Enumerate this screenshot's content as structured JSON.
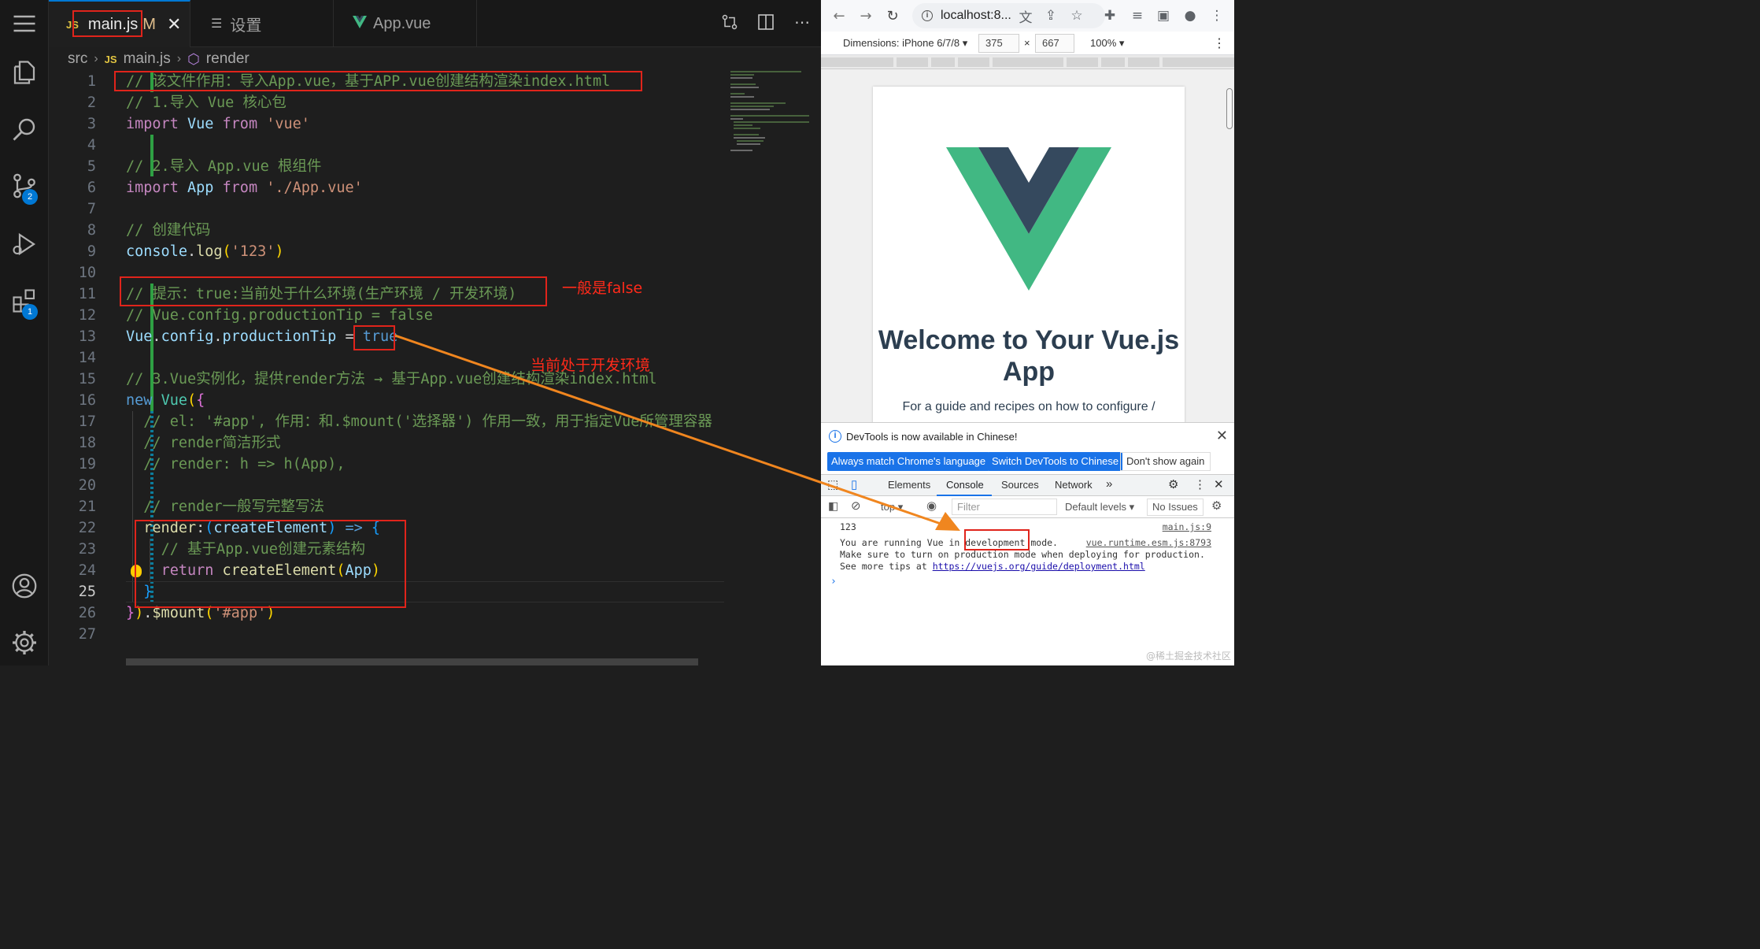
{
  "tabs": [
    {
      "label": "main.js",
      "modified": "M",
      "icon": "JS",
      "active": true
    },
    {
      "label": "设置",
      "active": false
    },
    {
      "label": "App.vue",
      "active": false
    }
  ],
  "breadcrumb": [
    "src",
    "main.js",
    "render"
  ],
  "activity": {
    "scm_badge": "2",
    "extensions_badge": "1"
  },
  "editor": {
    "current_line": 25,
    "lines": [
      {
        "n": "1",
        "html": "<span class='c-comment'>// 该文件作用：导入App.vue，基于APP.vue创建结构渲染index.html</span>"
      },
      {
        "n": "2",
        "html": "<span class='c-comment'>// 1.导入 Vue 核心包</span>"
      },
      {
        "n": "3",
        "html": "<span class='c-kw'>import</span> <span class='c-var'>Vue</span> <span class='c-kw'>from</span> <span class='c-str'>'vue'</span>"
      },
      {
        "n": "4",
        "html": ""
      },
      {
        "n": "5",
        "html": "<span class='c-comment'>// 2.导入 App.vue 根组件</span>"
      },
      {
        "n": "6",
        "html": "<span class='c-kw'>import</span> <span class='c-var'>App</span> <span class='c-kw'>from</span> <span class='c-str'>'./App.vue'</span>"
      },
      {
        "n": "7",
        "html": ""
      },
      {
        "n": "8",
        "html": "<span class='c-comment'>// 创建代码</span>"
      },
      {
        "n": "9",
        "html": "<span class='c-var'>console</span><span class='c-pun'>.</span><span class='c-fn'>log</span><span class='c-brace1'>(</span><span class='c-str'>'123'</span><span class='c-brace1'>)</span>"
      },
      {
        "n": "10",
        "html": ""
      },
      {
        "n": "11",
        "html": "<span class='c-comment'>// 提示：true:当前处于什么环境(生产环境 / 开发环境)</span>"
      },
      {
        "n": "12",
        "html": "<span class='c-comment'>// Vue.config.productionTip = false</span>"
      },
      {
        "n": "13",
        "html": "<span class='c-var'>Vue</span><span class='c-pun'>.</span><span class='c-var'>config</span><span class='c-pun'>.</span><span class='c-var'>productionTip</span> <span class='c-pun'>=</span> <span class='c-bool'>true</span>"
      },
      {
        "n": "14",
        "html": ""
      },
      {
        "n": "15",
        "html": "<span class='c-comment'>// 3.Vue实例化，提供render方法 → 基于App.vue创建结构渲染index.html</span>"
      },
      {
        "n": "16",
        "html": "<span class='c-bool'>new</span> <span class='c-cls'>Vue</span><span class='c-brace1'>(</span><span class='c-brace2'>{</span>"
      },
      {
        "n": "17",
        "html": "  <span class='c-comment'>// el: '#app', 作用：和.$mount('选择器') 作用一致，用于指定Vue所管理容器</span>"
      },
      {
        "n": "18",
        "html": "  <span class='c-comment'>// render简洁形式</span>"
      },
      {
        "n": "19",
        "html": "  <span class='c-comment'>// render: h => h(App),</span>"
      },
      {
        "n": "20",
        "html": ""
      },
      {
        "n": "21",
        "html": "  <span class='c-comment'>// render一般写完整写法</span>"
      },
      {
        "n": "22",
        "html": "  <span class='c-fn'>render</span><span class='c-pun'>:</span><span class='c-brace3'>(</span><span class='c-var'>createElement</span><span class='c-brace3'>)</span> <span class='c-bool'>=></span> <span class='c-brace3'>{</span>"
      },
      {
        "n": "23",
        "html": "    <span class='c-comment'>// 基于App.vue创建元素结构</span>"
      },
      {
        "n": "24",
        "html": "    <span class='c-kw'>return</span> <span class='c-fn'>createElement</span><span class='c-brace1'>(</span><span class='c-var'>App</span><span class='c-brace1'>)</span>"
      },
      {
        "n": "25",
        "html": "  <span class='c-brace3'>}</span>"
      },
      {
        "n": "26",
        "html": "<span class='c-brace2'>}</span><span class='c-brace1'>)</span><span class='c-pun'>.</span><span class='c-fn'>$mount</span><span class='c-brace1'>(</span><span class='c-str'>'#app'</span><span class='c-brace1'>)</span>"
      },
      {
        "n": "27",
        "html": ""
      }
    ]
  },
  "annotations": {
    "false_note": "一般是false",
    "dev_note": "当前处于开发环境"
  },
  "browser": {
    "url": "localhost:8...",
    "device": "Dimensions: iPhone 6/7/8",
    "width": "375",
    "height": "667",
    "zoom": "100%",
    "welcome": "Welcome to Your Vue.js App",
    "guide": "For a guide and recipes on how to configure /",
    "vue_green": "#41b883",
    "vue_dark": "#35495e"
  },
  "devtools": {
    "banner": "DevTools is now available in Chinese!",
    "btn_match": "Always match Chrome's language",
    "btn_switch": "Switch DevTools to Chinese",
    "btn_dont": "Don't show again",
    "tabs": [
      "Elements",
      "Console",
      "Sources",
      "Network"
    ],
    "context": "top",
    "filter_placeholder": "Filter",
    "levels": "Default levels",
    "issues": "No Issues",
    "log_123": "123",
    "src_main": "main.js:9",
    "msg_pre": "You are running Vue in ",
    "msg_highlight": "development",
    "msg_post": " mode.",
    "src_runtime": "vue.runtime.esm.js:8793",
    "msg_line2": "Make sure to turn on production mode when deploying for production.",
    "msg_line3_pre": "See more tips at ",
    "msg_link": "https://vuejs.org/guide/deployment.html"
  },
  "watermark": "@稀土掘金技术社区"
}
